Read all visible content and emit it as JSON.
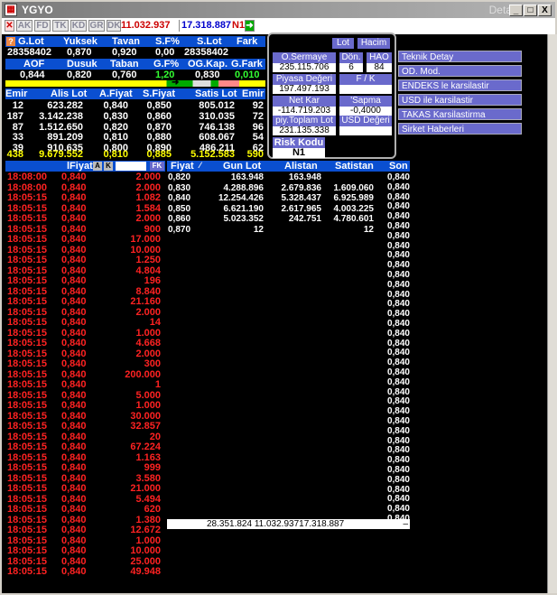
{
  "window": {
    "title": "YGYO",
    "title_right": "Detay",
    "min": "_",
    "max": "□",
    "close": "X"
  },
  "toolbar": {
    "buttons": [
      "AK",
      "FD",
      "TK",
      "KD",
      "GR",
      "DK"
    ],
    "val1": "11.032.937",
    "val2": "17.318.887",
    "n1": "N1"
  },
  "summary": {
    "row1_labels": [
      "G.Lot",
      "Yuksek",
      "Tavan",
      "S.F%",
      "S.Lot",
      "Fark"
    ],
    "row1_values": [
      "28358402",
      "0,870",
      "0,920",
      "0,00",
      "28358402",
      ""
    ],
    "row2_labels": [
      "AOF",
      "Dusuk",
      "Taban",
      "G.F%",
      "OG.Kap.",
      "G.Fark"
    ],
    "row2_values": [
      "0,844",
      "0,820",
      "0,760",
      "1,20",
      "0,830",
      "0,010"
    ]
  },
  "depth": {
    "headers": [
      "Emir",
      "Alis Lot",
      "A.Fiyat",
      "S.Fiyat",
      "Satis Lot",
      "Emir"
    ],
    "rows": [
      [
        "12",
        "623.282",
        "0,840",
        "0,850",
        "805.012",
        "92"
      ],
      [
        "187",
        "3.142.238",
        "0,830",
        "0,860",
        "310.035",
        "72"
      ],
      [
        "87",
        "1.512.650",
        "0,820",
        "0,870",
        "746.138",
        "96"
      ],
      [
        "33",
        "891.209",
        "0,810",
        "0,880",
        "608.067",
        "54"
      ],
      [
        "39",
        "910.635",
        "0,800",
        "0,890",
        "486.211",
        "62"
      ]
    ],
    "totals": [
      "438",
      "9.679.552",
      "0,810",
      "0,885",
      "5.152.583",
      "590"
    ]
  },
  "panel": {
    "lot": "Lot",
    "hacim": "Hacim",
    "osermaye": "O.Sermaye",
    "osermaye_val": "235.115.706",
    "don": "Dön.",
    "don_val": "6",
    "hao": "HAO",
    "hao_val": "84",
    "piyasa": "Piyasa Değeri",
    "piyasa_val": "197.497.193",
    "fk": "F / K",
    "fk_val": "",
    "netkar": "Net Kar",
    "netkar_val": "-114.719.203",
    "sapma": "'Sapma",
    "sapma_val": "-0,4000",
    "piyToplam": "piy.Toplam Lot",
    "piyToplam_val": "231.135.338",
    "usd": "USD Değeri",
    "usd_val": "",
    "risk": "Risk Kodu",
    "risk_val": "N1"
  },
  "menu": [
    "Teknik Detay",
    "OD. Mod.",
    "ENDEKS le karsilastir",
    "USD ile karsilastir",
    "TAKAS Karsilastirma",
    "Sirket Haberleri"
  ],
  "trades_header": {
    "fiyat": "lFiyat",
    "a": "A",
    "k": "K",
    "fk": "FK"
  },
  "trades": [
    [
      "18:08:00",
      "0,840",
      "2.000"
    ],
    [
      "18:08:00",
      "0,840",
      "2.000"
    ],
    [
      "18:05:15",
      "0,840",
      "1.082"
    ],
    [
      "18:05:15",
      "0,840",
      "1.584"
    ],
    [
      "18:05:15",
      "0,840",
      "2.000"
    ],
    [
      "18:05:15",
      "0,840",
      "900"
    ],
    [
      "18:05:15",
      "0,840",
      "17.000"
    ],
    [
      "18:05:15",
      "0,840",
      "10.000"
    ],
    [
      "18:05:15",
      "0,840",
      "1.250"
    ],
    [
      "18:05:15",
      "0,840",
      "4.804"
    ],
    [
      "18:05:15",
      "0,840",
      "196"
    ],
    [
      "18:05:15",
      "0,840",
      "8.840"
    ],
    [
      "18:05:15",
      "0,840",
      "21.160"
    ],
    [
      "18:05:15",
      "0,840",
      "2.000"
    ],
    [
      "18:05:15",
      "0,840",
      "14"
    ],
    [
      "18:05:15",
      "0,840",
      "1.000"
    ],
    [
      "18:05:15",
      "0,840",
      "4.668"
    ],
    [
      "18:05:15",
      "0,840",
      "2.000"
    ],
    [
      "18:05:15",
      "0,840",
      "300"
    ],
    [
      "18:05:15",
      "0,840",
      "200.000"
    ],
    [
      "18:05:15",
      "0,840",
      "1"
    ],
    [
      "18:05:15",
      "0,840",
      "5.000"
    ],
    [
      "18:05:15",
      "0,840",
      "1.000"
    ],
    [
      "18:05:15",
      "0,840",
      "30.000"
    ],
    [
      "18:05:15",
      "0,840",
      "32.857"
    ],
    [
      "18:05:15",
      "0,840",
      "20"
    ],
    [
      "18:05:15",
      "0,840",
      "67.224"
    ],
    [
      "18:05:15",
      "0,840",
      "1.163"
    ],
    [
      "18:05:15",
      "0,840",
      "999"
    ],
    [
      "18:05:15",
      "0,840",
      "3.580"
    ],
    [
      "18:05:15",
      "0,840",
      "21.000"
    ],
    [
      "18:05:15",
      "0,840",
      "5.494"
    ],
    [
      "18:05:15",
      "0,840",
      "620"
    ],
    [
      "18:05:15",
      "0,840",
      "1.380"
    ],
    [
      "18:05:15",
      "0,840",
      "12.672"
    ],
    [
      "18:05:15",
      "0,840",
      "1.000"
    ],
    [
      "18:05:15",
      "0,840",
      "10.000"
    ],
    [
      "18:05:15",
      "0,840",
      "25.000"
    ],
    [
      "18:05:15",
      "0,840",
      "49.948"
    ]
  ],
  "dist_header": [
    "Fiyat",
    "Gun Lot",
    "Alistan",
    "Satistan",
    "Son"
  ],
  "dist": [
    [
      "0,820",
      "163.948",
      "163.948",
      ""
    ],
    [
      "0,830",
      "4.288.896",
      "2.679.836",
      "1.609.060"
    ],
    [
      "0,840",
      "12.254.426",
      "5.328.437",
      "6.925.989"
    ],
    [
      "0,850",
      "6.621.190",
      "2.617.965",
      "4.003.225"
    ],
    [
      "0,860",
      "5.023.352",
      "242.751",
      "4.780.601"
    ],
    [
      "0,870",
      "12",
      "",
      "12"
    ]
  ],
  "dist_total": "28.351.824 11.032.93717.318.887",
  "son_value": "0,840",
  "son_count": 36
}
